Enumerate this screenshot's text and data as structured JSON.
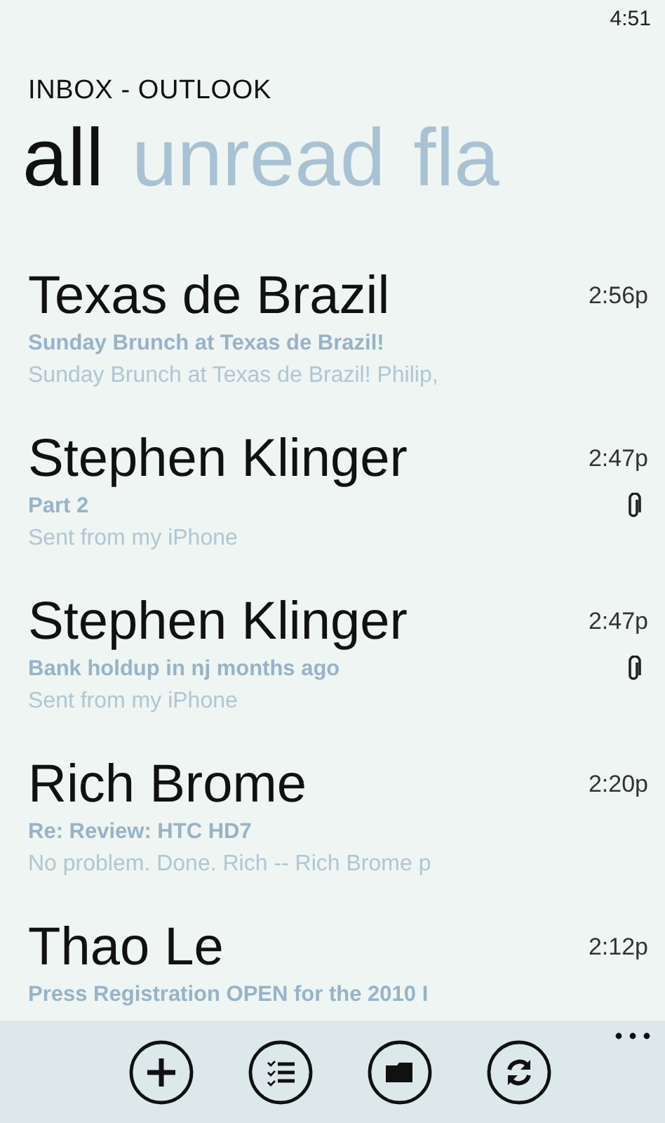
{
  "status_bar": {
    "time": "4:51"
  },
  "title": "INBOX - OUTLOOK",
  "pivots": [
    {
      "label": "all",
      "selected": true
    },
    {
      "label": "unread",
      "selected": false
    },
    {
      "label": "fla",
      "selected": false
    }
  ],
  "messages": [
    {
      "sender": "Texas de Brazil",
      "time": "2:56p",
      "subject": "Sunday Brunch at Texas de Brazil!",
      "preview": "Sunday Brunch at Texas de Brazil! Philip,",
      "attachment": false
    },
    {
      "sender": "Stephen Klinger",
      "time": "2:47p",
      "subject": "Part 2",
      "preview": "Sent from my iPhone",
      "attachment": true
    },
    {
      "sender": "Stephen Klinger",
      "time": "2:47p",
      "subject": "Bank holdup in nj months ago",
      "preview": "Sent from my iPhone",
      "attachment": true
    },
    {
      "sender": "Rich Brome",
      "time": "2:20p",
      "subject": "Re: Review: HTC HD7",
      "preview": "No problem. Done. Rich -- Rich Brome p",
      "attachment": false
    },
    {
      "sender": "Thao Le",
      "time": "2:12p",
      "subject": "Press Registration OPEN for the 2010 I"
    }
  ],
  "app_bar": {
    "buttons": [
      {
        "kind": "new"
      },
      {
        "kind": "select"
      },
      {
        "kind": "folders"
      },
      {
        "kind": "sync"
      }
    ]
  }
}
